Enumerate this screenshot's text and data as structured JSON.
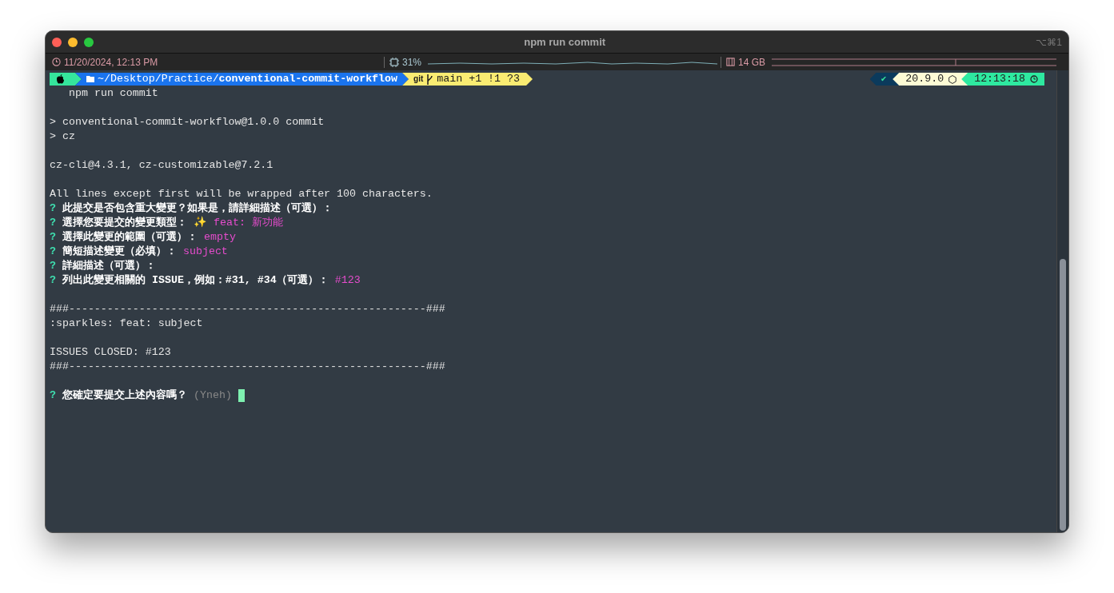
{
  "window": {
    "title": "npm run commit",
    "shortcut": "⌥⌘1"
  },
  "status_bar": {
    "datetime": "11/20/2024, 12:13 PM",
    "cpu": "31%",
    "memory": "14 GB"
  },
  "prompt": {
    "path_prefix": "~/Desktop/Practice/",
    "path_current": "conventional-commit-workflow",
    "git_label": "git",
    "git_status": "main +1 !1 ?3",
    "status_mark": "✔",
    "node_version": "20.9.0",
    "time": "12:13:18"
  },
  "command": "npm run commit",
  "lines": [
    {
      "kind": "blank"
    },
    {
      "kind": "text",
      "text": "> conventional-commit-workflow@1.0.0 commit"
    },
    {
      "kind": "text",
      "text": "> cz"
    },
    {
      "kind": "blank"
    },
    {
      "kind": "text",
      "text": "cz-cli@4.3.1, cz-customizable@7.2.1"
    },
    {
      "kind": "blank"
    },
    {
      "kind": "text",
      "text": "All lines except first will be wrapped after 100 characters."
    },
    {
      "kind": "question",
      "mark": "?",
      "text": "此提交是否包含重大變更？如果是，請詳細描述（可選）："
    },
    {
      "kind": "question",
      "mark": "?",
      "text": "選擇您要提交的變更類型：",
      "answer": "✨ feat: 新功能"
    },
    {
      "kind": "question",
      "mark": "?",
      "text": "選擇此變更的範圍（可選）：",
      "answer": "empty"
    },
    {
      "kind": "question",
      "mark": "?",
      "text": "簡短描述變更（必填）：",
      "answer": "subject"
    },
    {
      "kind": "question",
      "mark": "?",
      "text": "詳細描述（可選）："
    },
    {
      "kind": "question",
      "mark": "?",
      "text": "列出此變更相關的 ISSUE，例如：#31, #34（可選）：",
      "answer": "#123"
    },
    {
      "kind": "blank"
    },
    {
      "kind": "text",
      "text": "###--------------------------------------------------------###"
    },
    {
      "kind": "text",
      "text": ":sparkles: feat: subject"
    },
    {
      "kind": "blank"
    },
    {
      "kind": "text",
      "text": "ISSUES CLOSED: #123"
    },
    {
      "kind": "text",
      "text": "###--------------------------------------------------------###"
    },
    {
      "kind": "blank"
    },
    {
      "kind": "question",
      "mark": "?",
      "text": "您確定要提交上述內容嗎？",
      "hint": "(Yneh)",
      "cursor": true
    }
  ]
}
